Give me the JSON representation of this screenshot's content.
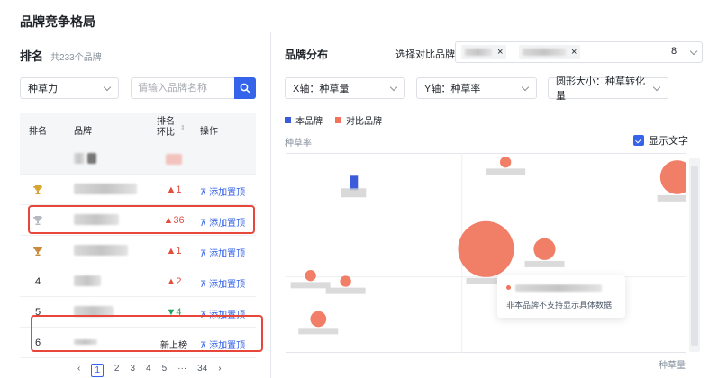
{
  "page": {
    "title": "品牌竞争格局"
  },
  "ranking": {
    "title": "排名",
    "subtitle": "共233个品牌",
    "metric_select": "种草力",
    "search_placeholder": "请输入品牌名称",
    "columns": {
      "rank": "排名",
      "brand": "品牌",
      "change": "排名\n环比",
      "action": "操作"
    },
    "rows": [
      {
        "rank": "",
        "change": "",
        "action": ""
      },
      {
        "rank": "trophy-gold",
        "change": "▲1",
        "dir": "up",
        "action": "添加置顶"
      },
      {
        "rank": "trophy-silver",
        "change": "▲36",
        "dir": "up",
        "action": "添加置顶"
      },
      {
        "rank": "trophy-bronze",
        "change": "▲1",
        "dir": "up",
        "action": "添加置顶"
      },
      {
        "rank": "4",
        "change": "▲2",
        "dir": "up",
        "action": "添加置顶"
      },
      {
        "rank": "5",
        "change": "▼4",
        "dir": "down",
        "action": "添加置顶"
      },
      {
        "rank": "6",
        "change": "新上榜",
        "dir": "new",
        "action": "添加置顶"
      }
    ],
    "pagination": [
      "‹",
      "1",
      "2",
      "3",
      "4",
      "5",
      "···",
      "34",
      "›"
    ],
    "current_page": "1"
  },
  "distribution": {
    "title": "品牌分布",
    "compare_label": "选择对比品牌",
    "compare_count": "8",
    "x_axis_select": "X轴：种草量",
    "y_axis_select": "Y轴：种草率",
    "size_select": "圆形大小：种草转化量",
    "legend": {
      "own": "本品牌",
      "compare": "对比品牌"
    },
    "show_text": "显示文字",
    "tooltip_line2": "非本品牌不支持显示具体数据",
    "colors": {
      "own": "#3b5bdb",
      "compare": "#f0735a",
      "accent": "#3563e9",
      "highlight": "#e8463b"
    }
  },
  "chart_data": {
    "type": "scatter",
    "xlabel": "种草量",
    "ylabel": "种草率",
    "grid": true,
    "series": [
      {
        "name": "本品牌",
        "points": [
          {
            "x": 0.16,
            "y": 0.87,
            "size": 0.1,
            "shape": "bar"
          }
        ]
      },
      {
        "name": "对比品牌",
        "points": [
          {
            "x": 0.55,
            "y": 0.98,
            "size": 0.08
          },
          {
            "x": 0.99,
            "y": 0.9,
            "size": 0.55
          },
          {
            "x": 0.5,
            "y": 0.52,
            "size": 1.0
          },
          {
            "x": 0.65,
            "y": 0.52,
            "size": 0.3
          },
          {
            "x": 0.05,
            "y": 0.38,
            "size": 0.08
          },
          {
            "x": 0.14,
            "y": 0.35,
            "size": 0.08
          },
          {
            "x": 0.07,
            "y": 0.15,
            "size": 0.18
          }
        ]
      }
    ]
  }
}
